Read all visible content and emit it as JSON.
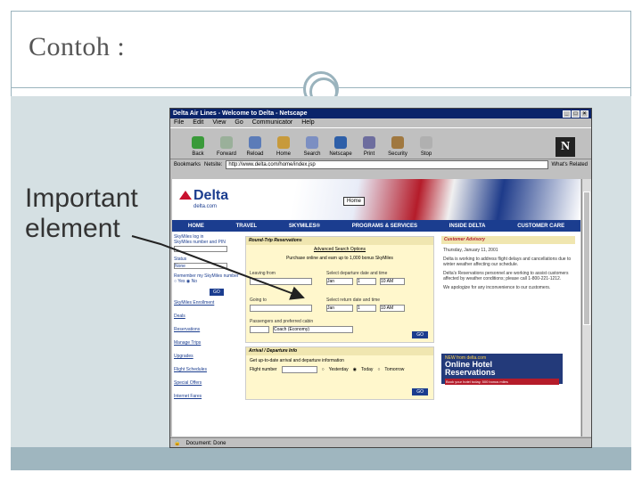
{
  "slide": {
    "title": "Contoh :",
    "side_label_line1": "Important",
    "side_label_line2": "element"
  },
  "browser": {
    "window_title": "Delta Air Lines - Welcome to Delta - Netscape",
    "menu": [
      "File",
      "Edit",
      "View",
      "Go",
      "Communicator",
      "Help"
    ],
    "toolbar": [
      "Back",
      "Forward",
      "Reload",
      "Home",
      "Search",
      "Netscape",
      "Print",
      "Security",
      "Stop"
    ],
    "location_label": "Netsite:",
    "bookmarks_label": "Bookmarks",
    "url": "http://www.delta.com/home/index.jsp",
    "whats_related": "What's Related",
    "status": "Document: Done"
  },
  "site": {
    "logo": "Delta",
    "logo_domain": "delta.com",
    "home_tooltip": "Home",
    "nav": [
      "HOME",
      "TRAVEL",
      "SKYMILES®",
      "PROGRAMS & SERVICES",
      "INSIDE DELTA",
      "CUSTOMER CARE"
    ],
    "left": {
      "login_label": "SkyMiles log in",
      "login_sub": "SkyMiles number and PIN",
      "status_label": "Status",
      "status_value": "None",
      "remember_label": "Remember my SkyMiles number",
      "yes": "Yes",
      "no": "No",
      "go": "GO",
      "links": [
        "SkyMiles Enrollment",
        "Deals",
        "Reservations",
        "Manage Trips",
        "Upgrades",
        "Flight Schedules",
        "Special Offers",
        "Internet Fares"
      ]
    },
    "reservations": {
      "title": "Round-Trip Reservations",
      "sub": "Advanced Search Options",
      "prompt": "Purchase online and earn up to 1,000 bonus SkyMiles",
      "from_label": "Leaving from",
      "to_label": "Going to",
      "depart_label": "Select departure date and time",
      "return_label": "Select return date and time",
      "month": "Jan",
      "day": "1",
      "time": "10 AM",
      "passengers_label": "Passengers and preferred cabin",
      "cabin": "Coach (Economy)",
      "go": "GO"
    },
    "arrival": {
      "title": "Arrival / Departure Info",
      "prompt": "Get up-to-date arrival and departure information",
      "flight_label": "Flight number",
      "yesterday": "Yesterday",
      "today": "Today",
      "tomorrow": "Tomorrow",
      "go": "GO"
    },
    "advisory": {
      "title": "Customer Advisory",
      "date": "Thursday, January 11, 2001",
      "p1": "Delta is working to address flight delays and cancellations due to winter weather affecting our schedule.",
      "p2": "Delta's Reservations personnel are working to assist customers affected by weather conditions; please call 1-800-221-1212.",
      "p3": "We apologize for any inconvenience to our customers."
    },
    "ad": {
      "line1": "NEW from delta.com",
      "line2": "Online Hotel",
      "line3": "Reservations",
      "line4": "Book your hotel today, 500 bonus miles"
    }
  },
  "colors": {
    "accent": "#9ab3bd",
    "delta_blue": "#1b3d8f",
    "delta_red": "#c8102e"
  }
}
